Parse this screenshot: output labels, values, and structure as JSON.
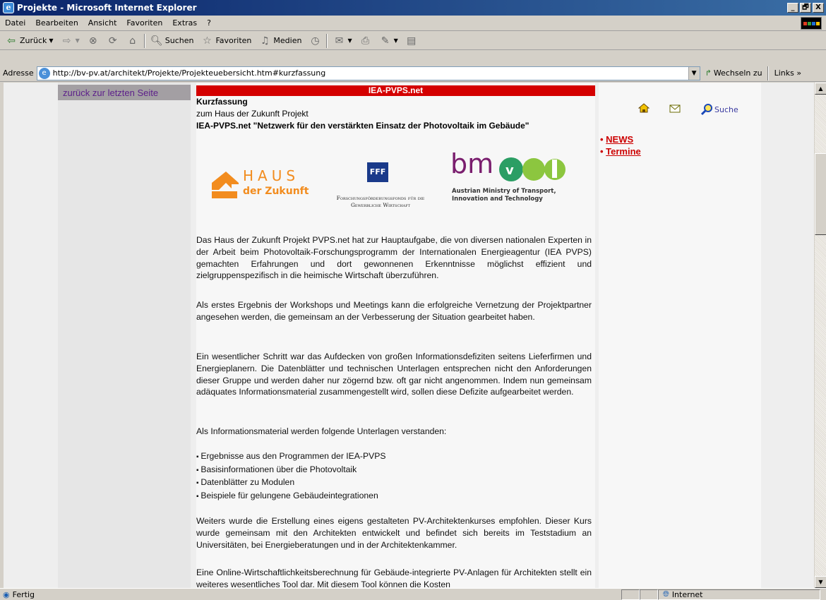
{
  "window": {
    "title": "Projekte - Microsoft Internet Explorer",
    "minimize": "_",
    "maximize": "🗗",
    "close": "X"
  },
  "menu": [
    "Datei",
    "Bearbeiten",
    "Ansicht",
    "Favoriten",
    "Extras",
    "?"
  ],
  "toolbar": {
    "back_label": "Zurück",
    "search_label": "Suchen",
    "favorites_label": "Favoriten",
    "media_label": "Medien"
  },
  "address": {
    "label": "Adresse",
    "url": "http://bv-pv.at/architekt/Projekte/Projekteuebersicht.htm#kurzfassung",
    "go_label": "Wechseln zu",
    "links_label": "Links »"
  },
  "page": {
    "back_link": "zurück zur letzten Seite",
    "banner": "IEA-PVPS.net",
    "heading1": "Kurzfassung",
    "heading2": "zum Haus der Zukunft Projekt",
    "heading3": "IEA-PVPS.net \"Netzwerk für den verstärkten Einsatz der Photovoltaik im Gebäude\"",
    "logos": {
      "haus_line1": "HAUS",
      "haus_line2": "der Zukunft",
      "fff_mark": "FFF",
      "fff_line1": "Forschungsförderungsfonds für die",
      "fff_line2": "Gewerbliche Wirtschaft",
      "bmvit_mark": "bm",
      "bmvit_line1": "Austrian Ministry of Transport,",
      "bmvit_line2": "Innovation and Technology"
    },
    "paragraphs": [
      "Das Haus der Zukunft Projekt PVPS.net hat zur Hauptaufgabe, die von diversen nationalen Experten in der Arbeit beim Photovoltaik-Forschungsprogramm der Internationalen Energieagentur (IEA PVPS) gemachten Erfahrungen und dort gewonnenen Erkenntnisse möglichst effizient und zielgruppenspezifisch in die heimische Wirtschaft überzuführen.",
      "Als erstes Ergebnis der Workshops und Meetings kann die erfolgreiche Vernetzung der Projektpartner angesehen werden, die gemeinsam an der Verbesserung der Situation gearbeitet haben.",
      "Ein wesentlicher Schritt war das Aufdecken von großen Informationsdefiziten seitens Lieferfirmen und Energieplanern. Die Datenblätter und technischen Unterlagen entsprechen nicht den Anforderungen dieser Gruppe und werden daher nur zögernd bzw. oft gar nicht angenommen. Indem nun gemeinsam adäquates Informationsmaterial zusammengestellt wird, sollen diese Defizite aufgearbeitet werden.",
      "Als Informationsmaterial werden folgende Unterlagen verstanden:",
      "Weiters wurde die Erstellung eines eigens gestalteten PV-Architektenkurses empfohlen. Dieser Kurs wurde gemeinsam mit den Architekten entwickelt und befindet sich bereits im Teststadium an Universitäten, bei Energieberatungen und in der Architektenkammer.",
      "Eine Online-Wirtschaftlichkeitsberechnung für Gebäude-integrierte PV-Anlagen für Architekten stellt ein weiteres wesentliches Tool dar. Mit diesem Tool können die Kosten"
    ],
    "bullets": [
      "Ergebnisse aus den Programmen der IEA-PVPS",
      "Basisinformationen über die Photovoltaik",
      "Datenblätter zu Modulen",
      "Beispiele für gelungene Gebäudeintegrationen"
    ],
    "right": {
      "search_label": "Suche",
      "news": "NEWS",
      "termine": "Termine"
    }
  },
  "status": {
    "left": "Fertig",
    "zone": "Internet"
  }
}
